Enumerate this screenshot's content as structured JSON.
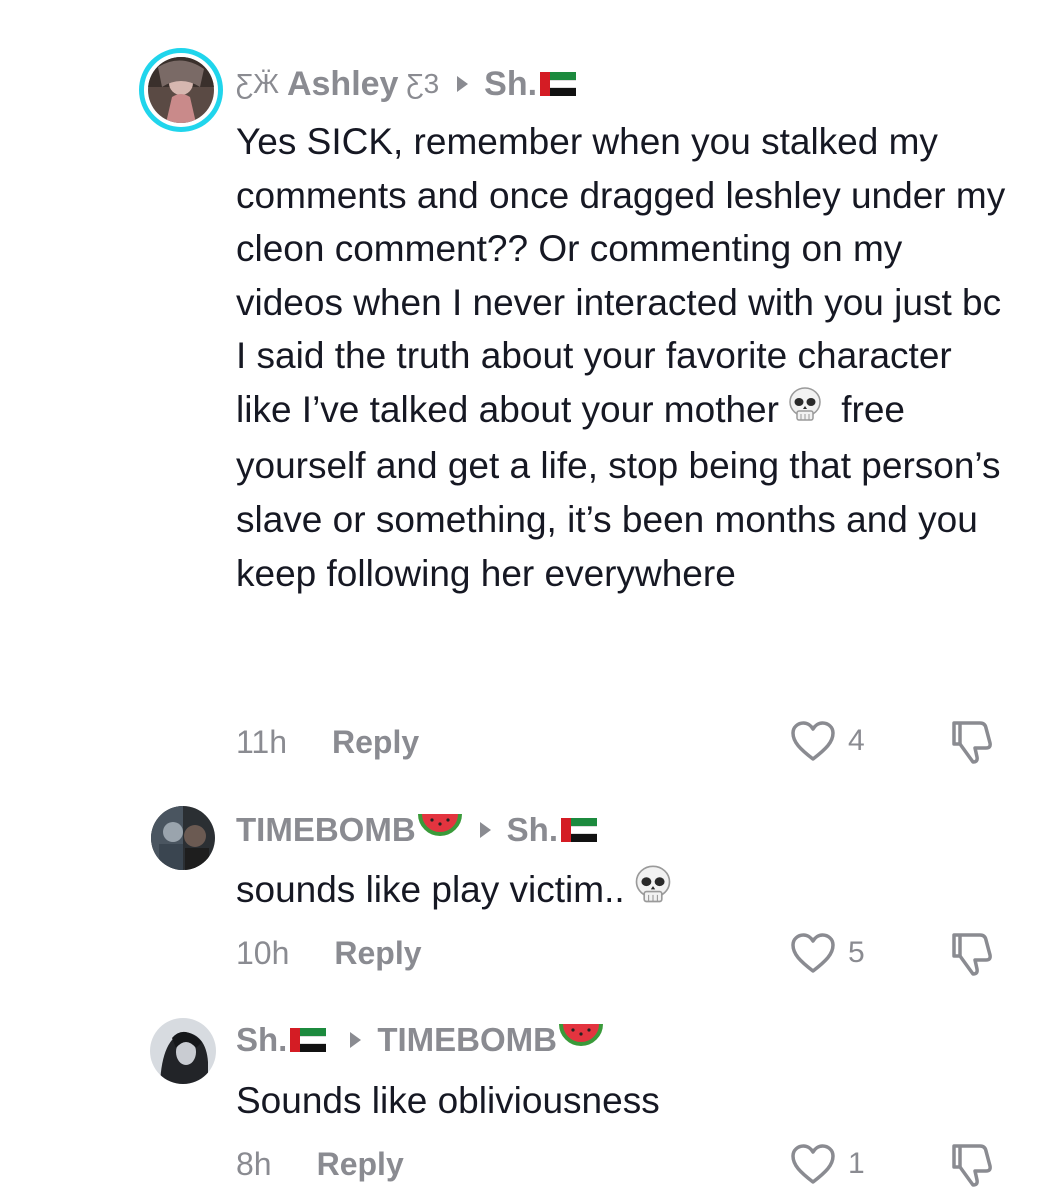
{
  "comments": [
    {
      "author": "Ashley",
      "author_prefix": "ƸӜ",
      "author_suffix": "Ƹ3",
      "reply_to": "Sh.",
      "text_parts": [
        "Yes SICK, remember when you stalked my comments and once dragged leshley under my cleon comment?? Or commenting on my videos when I never interacted with you just bc I said the truth about your favorite character like I’ve talked about your mother",
        " free yourself and get a life, stop being that person’s slave or something, it’s been months and you keep following her everywhere"
      ],
      "time": "11h",
      "reply_label": "Reply",
      "likes": "4"
    },
    {
      "author": "TIMEBOMB",
      "reply_to": "Sh.",
      "text": "sounds like play victim..",
      "time": "10h",
      "reply_label": "Reply",
      "likes": "5"
    },
    {
      "author": "Sh.",
      "reply_to": "TIMEBOMB",
      "text": "Sounds like obliviousness",
      "time": "8h",
      "reply_label": "Reply",
      "likes": "1"
    }
  ],
  "colors": {
    "story_ring": "#20d5ec",
    "muted_text": "#8a8b91",
    "body_text": "#161823"
  },
  "icons": [
    "heart-icon",
    "dislike-icon",
    "skull-emoji",
    "watermelon-emoji",
    "uae-flag-emoji",
    "reply-arrow-icon"
  ]
}
